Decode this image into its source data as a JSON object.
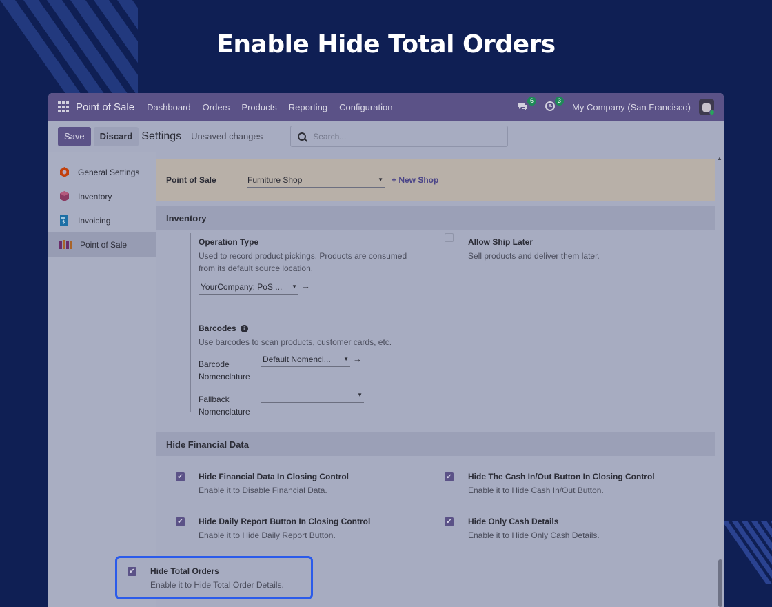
{
  "hero": {
    "title": "Enable Hide Total Orders"
  },
  "navbar": {
    "brand": "Point of Sale",
    "menu": [
      "Dashboard",
      "Orders",
      "Products",
      "Reporting",
      "Configuration"
    ],
    "messages_badge": "6",
    "activities_badge": "3",
    "company": "My Company (San Francisco)"
  },
  "control_panel": {
    "save_label": "Save",
    "discard_label": "Discard",
    "title": "Settings",
    "status": "Unsaved changes",
    "search_placeholder": "Search..."
  },
  "sidebar": {
    "items": [
      {
        "label": "General Settings",
        "color": "#c2410c"
      },
      {
        "label": "Inventory",
        "color": "#8b3a62"
      },
      {
        "label": "Invoicing",
        "color": "#1d6fa5"
      },
      {
        "label": "Point of Sale",
        "color": "#6b2d6b"
      }
    ]
  },
  "pos": {
    "label": "Point of Sale",
    "shop": "Furniture Shop",
    "new_shop": "+ New Shop"
  },
  "inventory": {
    "heading": "Inventory",
    "operation_type": {
      "title": "Operation Type",
      "desc_line1": "Used to record product pickings. Products are consumed",
      "desc_line2": "from its default source location.",
      "value": "YourCompany: PoS ..."
    },
    "allow_ship_later": {
      "title": "Allow Ship Later",
      "desc": "Sell products and deliver them later.",
      "checked": false
    },
    "barcodes": {
      "title": "Barcodes",
      "desc": "Use barcodes to scan products, customer cards, etc.",
      "nomenclature_label_1": "Barcode",
      "nomenclature_label_2": "Nomenclature",
      "nomenclature_value": "Default Nomencl...",
      "fallback_label_1": "Fallback",
      "fallback_label_2": "Nomenclature",
      "fallback_value": ""
    }
  },
  "financial": {
    "heading": "Hide Financial Data",
    "items": [
      {
        "title": "Hide Financial Data In Closing Control",
        "desc": "Enable it to Disable Financial Data.",
        "checked": true
      },
      {
        "title": "Hide The Cash In/Out Button In Closing Control",
        "desc": "Enable it to Hide Cash In/Out Button.",
        "checked": true
      },
      {
        "title": "Hide Daily Report Button In Closing Control",
        "desc": "Enable it to Hide Daily Report Button.",
        "checked": true
      },
      {
        "title": "Hide Only Cash Details",
        "desc": "Enable it to Hide Only Cash Details.",
        "checked": true
      },
      {
        "title": "Hide Total Orders",
        "desc": "Enable it to Hide Total Order Details.",
        "checked": true
      }
    ]
  },
  "colors": {
    "page_bg": "#0f1f54",
    "navbar": "#5b5287",
    "highlight_border": "#2b5bea"
  }
}
